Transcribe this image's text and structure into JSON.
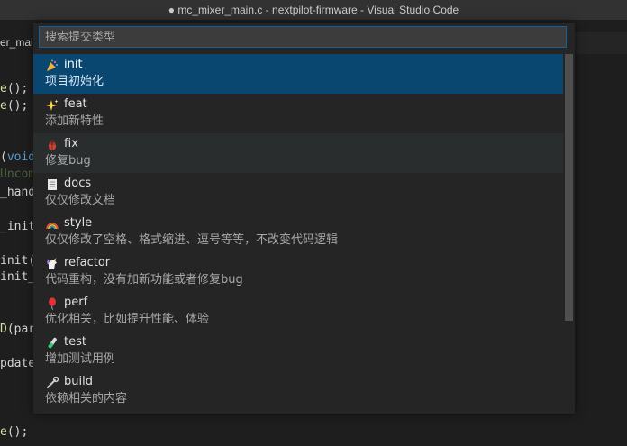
{
  "window": {
    "title": "● mc_mixer_main.c - nextpilot-firmware - Visual Studio Code"
  },
  "editor": {
    "tab_label": "er_mai",
    "lines": [
      {
        "pre": "",
        "fn": "e",
        "post": "();"
      },
      {
        "pre": "",
        "fn": "e",
        "post": "();"
      },
      {
        "pre": "",
        "fn": "",
        "post": "(",
        "kw": "void"
      },
      {
        "comment": "Uncomm"
      },
      {
        "pre": "_hand",
        "fn": "",
        "post": ""
      },
      {
        "pre": "_init_",
        "fn": "",
        "post": ""
      },
      {
        "pre": "init(",
        "fn": "",
        "post": ""
      },
      {
        "pre": "init_",
        "fn": "",
        "post": ""
      },
      {
        "pre": "",
        "fn": "D",
        "post": "(para"
      },
      {
        "pre": "pdate",
        "fn": "",
        "post": ""
      },
      {
        "pre": "",
        "fn": "e",
        "post": "();"
      }
    ]
  },
  "quick_pick": {
    "placeholder": "搜索提交类型",
    "items": [
      {
        "icon": "party-popper-icon",
        "label": "init",
        "description": "项目初始化",
        "state": "selected"
      },
      {
        "icon": "sparkles-icon",
        "label": "feat",
        "description": "添加新特性",
        "state": ""
      },
      {
        "icon": "bug-icon",
        "label": "fix",
        "description": "修复bug",
        "state": "hover"
      },
      {
        "icon": "document-icon",
        "label": "docs",
        "description": "仅仅修改文档",
        "state": ""
      },
      {
        "icon": "rainbow-icon",
        "label": "style",
        "description": "仅仅修改了空格、格式缩进、逗号等等，不改变代码逻辑",
        "state": ""
      },
      {
        "icon": "unicorn-icon",
        "label": "refactor",
        "description": "代码重构，没有加新功能或者修复bug",
        "state": ""
      },
      {
        "icon": "balloon-icon",
        "label": "perf",
        "description": "优化相关，比如提升性能、体验",
        "state": ""
      },
      {
        "icon": "test-tube-icon",
        "label": "test",
        "description": "增加测试用例",
        "state": ""
      },
      {
        "icon": "wrench-icon",
        "label": "build",
        "description": "依赖相关的内容",
        "state": ""
      }
    ]
  },
  "colors": {
    "accent": "#0e639c",
    "selection": "#094771",
    "background": "#1e1e1e",
    "panel": "#252526"
  }
}
